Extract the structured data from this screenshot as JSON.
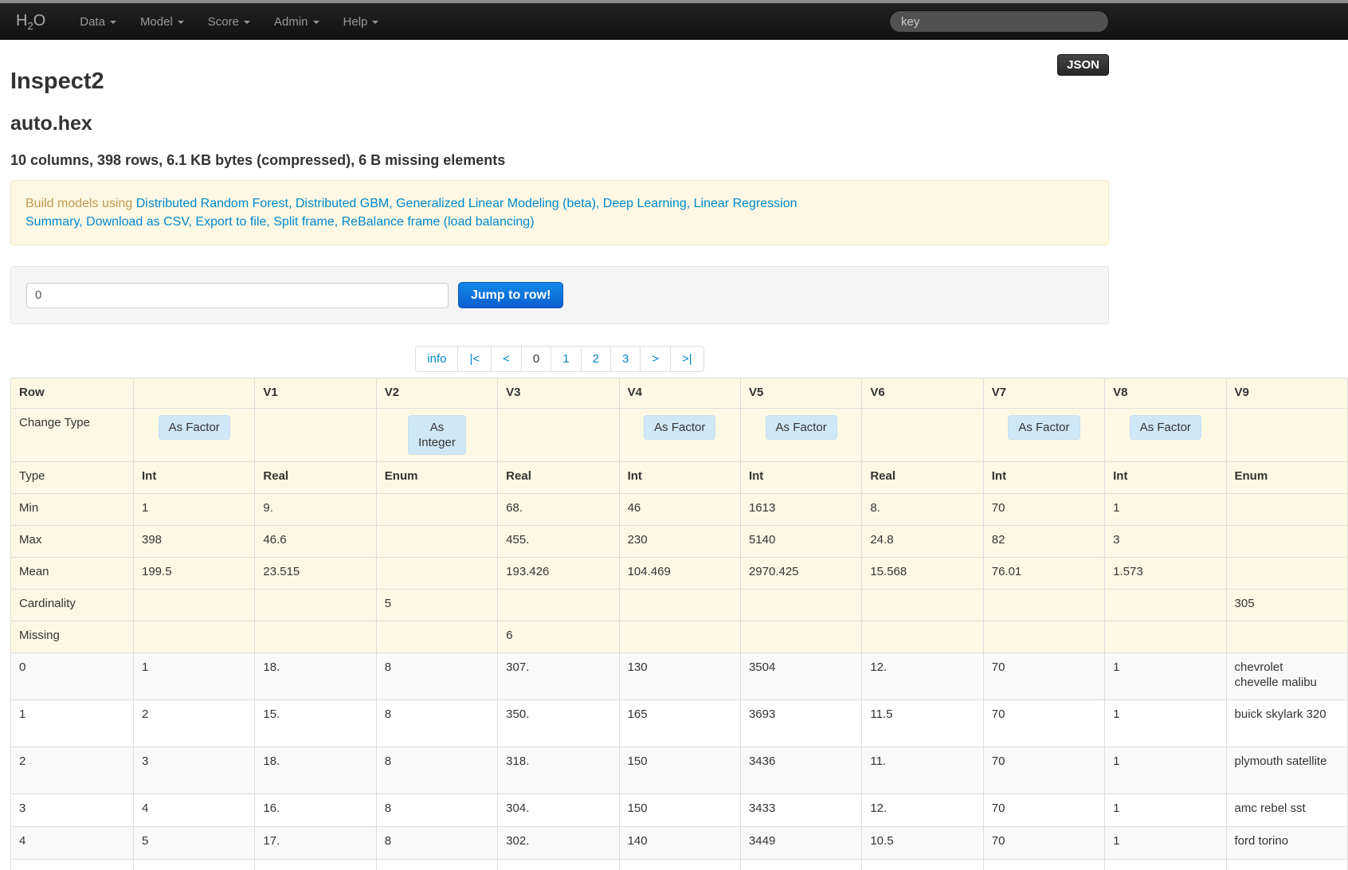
{
  "navbar": {
    "brand": {
      "h": "H",
      "sub": "2",
      "o": "O"
    },
    "items": [
      "Data",
      "Model",
      "Score",
      "Admin",
      "Help"
    ],
    "search_placeholder": "key"
  },
  "header": {
    "title": "Inspect2",
    "json_button_label": "JSON",
    "frame_name": "auto.hex",
    "summary": "10 columns, 398 rows, 6.1 KB bytes (compressed), 6 B missing elements"
  },
  "alert": {
    "prefix": "Build models using ",
    "model_links": [
      "Distributed Random Forest",
      "Distributed GBM",
      "Generalized Linear Modeling (beta)",
      "Deep Learning",
      "Linear Regression"
    ],
    "action_links": [
      "Summary",
      "Download as CSV",
      "Export to file",
      "Split frame",
      "ReBalance frame (load balancing)"
    ]
  },
  "jump_panel": {
    "input_value": "0",
    "button_label": "Jump to row!"
  },
  "pagination": {
    "items": [
      "info",
      "|<",
      "<",
      "0",
      "1",
      "2",
      "3",
      ">",
      ">|"
    ],
    "active": "0"
  },
  "table": {
    "header": {
      "row_label": "Row",
      "columns": [
        "",
        "V1",
        "V2",
        "V3",
        "V4",
        "V5",
        "V6",
        "V7",
        "V8",
        "V9"
      ]
    },
    "change_type_row": {
      "label": "Change Type",
      "buttons": [
        "As Factor",
        null,
        "As\nInteger",
        null,
        "As Factor",
        "As Factor",
        null,
        "As Factor",
        "As Factor",
        null
      ]
    },
    "stat_rows": [
      {
        "label": "Type",
        "bold": true,
        "values": [
          "Int",
          "Real",
          "Enum",
          "Real",
          "Int",
          "Int",
          "Real",
          "Int",
          "Int",
          "Enum"
        ]
      },
      {
        "label": "Min",
        "values": [
          "1",
          "9.",
          "",
          "68.",
          "46",
          "1613",
          "8.",
          "70",
          "1",
          ""
        ]
      },
      {
        "label": "Max",
        "values": [
          "398",
          "46.6",
          "",
          "455.",
          "230",
          "5140",
          "24.8",
          "82",
          "3",
          ""
        ]
      },
      {
        "label": "Mean",
        "values": [
          "199.5",
          "23.515",
          "",
          "193.426",
          "104.469",
          "2970.425",
          "15.568",
          "76.01",
          "1.573",
          ""
        ]
      },
      {
        "label": "Cardinality",
        "values": [
          "",
          "",
          "5",
          "",
          "",
          "",
          "",
          "",
          "",
          "305"
        ]
      },
      {
        "label": "Missing",
        "values": [
          "",
          "",
          "",
          "6",
          "",
          "",
          "",
          "",
          "",
          ""
        ]
      }
    ],
    "data_rows": [
      {
        "row": "0",
        "values": [
          "1",
          "18.",
          "8",
          "307.",
          "130",
          "3504",
          "12.",
          "70",
          "1",
          "chevrolet chevelle malibu"
        ]
      },
      {
        "row": "1",
        "values": [
          "2",
          "15.",
          "8",
          "350.",
          "165",
          "3693",
          "11.5",
          "70",
          "1",
          "buick skylark 320"
        ]
      },
      {
        "row": "2",
        "values": [
          "3",
          "18.",
          "8",
          "318.",
          "150",
          "3436",
          "11.",
          "70",
          "1",
          "plymouth satellite"
        ]
      },
      {
        "row": "3",
        "values": [
          "4",
          "16.",
          "8",
          "304.",
          "150",
          "3433",
          "12.",
          "70",
          "1",
          "amc rebel sst"
        ]
      },
      {
        "row": "4",
        "values": [
          "5",
          "17.",
          "8",
          "302.",
          "140",
          "3449",
          "10.5",
          "70",
          "1",
          "ford torino"
        ]
      }
    ]
  },
  "colors": {
    "link_blue": "#0088cc",
    "alert_text": "#c09853",
    "alert_bg": "#fcf8e3",
    "stat_row_bg": "#fcf8e3",
    "primary_button_blue": "#0b5ed0",
    "change_button_bg": "#cfe8f7"
  }
}
